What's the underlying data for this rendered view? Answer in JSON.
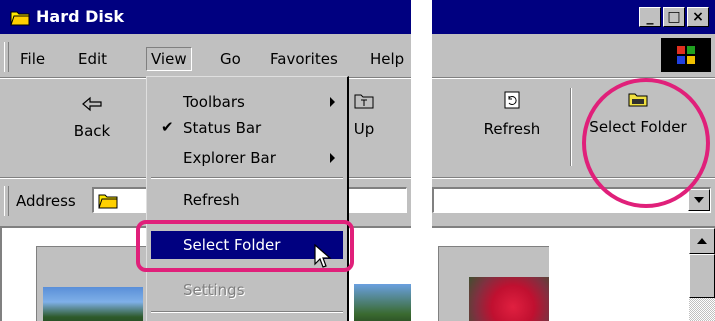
{
  "window": {
    "title": "Hard Disk"
  },
  "menubar": {
    "items": [
      "File",
      "Edit",
      "View",
      "Go",
      "Favorites",
      "Help"
    ]
  },
  "toolbar": {
    "back_label": "Back",
    "up_label": "Up",
    "refresh_label": "Refresh",
    "select_folder_label": "Select Folder"
  },
  "address": {
    "label": "Address"
  },
  "view_menu": {
    "toolbars": "Toolbars",
    "status_bar": "Status Bar",
    "explorer_bar": "Explorer Bar",
    "refresh": "Refresh",
    "select_folder": "Select Folder",
    "settings": "Settings"
  },
  "colors": {
    "titlebar": "#000080",
    "highlight": "#000080",
    "callout": "#e0207a",
    "face": "#c0c0c0"
  }
}
